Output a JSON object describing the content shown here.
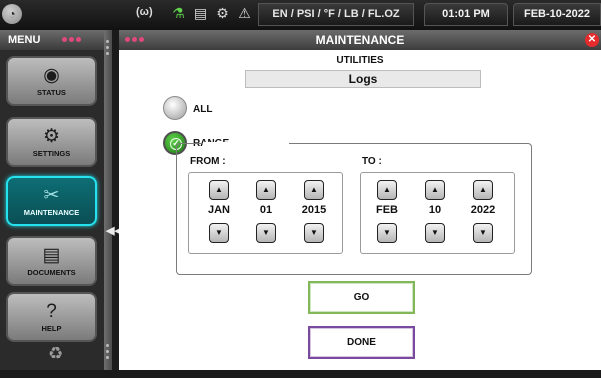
{
  "topbar": {
    "logo_icon": "gauge-logo-icon",
    "wifi_text": "(ω)",
    "icons": [
      "microscope-icon",
      "document-icon",
      "gear-green-icon",
      "warning-icon"
    ],
    "units_text": "EN / PSI / °F / LB / FL.OZ",
    "time_text": "01:01 PM",
    "date_text": "FEB-10-2022"
  },
  "sidebar": {
    "title": "MENU",
    "items": [
      {
        "label": "STATUS",
        "icon": "gauge-icon",
        "active": false
      },
      {
        "label": "SETTINGS",
        "icon": "gear-icon",
        "active": false
      },
      {
        "label": "MAINTENANCE",
        "icon": "tools-icon",
        "active": true
      },
      {
        "label": "DOCUMENTS",
        "icon": "document-icon",
        "active": false
      },
      {
        "label": "HELP",
        "icon": "help-icon",
        "active": false
      }
    ],
    "bottom_icon": "recycle-icon",
    "collapse_icon": "double-left-arrow-icon"
  },
  "main": {
    "title": "MAINTENANCE",
    "section": "UTILITIES",
    "logs_label": "Logs",
    "radio_all": "ALL",
    "radio_range": "RANGE",
    "selected_radio": "RANGE",
    "from_label": "FROM :",
    "to_label": "TO :",
    "from": {
      "month": "JAN",
      "day": "01",
      "year": "2015"
    },
    "to": {
      "month": "FEB",
      "day": "10",
      "year": "2022"
    },
    "go_label": "GO",
    "done_label": "DONE"
  },
  "colors": {
    "active_accent": "#25e2ee",
    "radio_selected": "#3fae2f",
    "go_border": "#83b85a",
    "done_border": "#7a4a9e",
    "close": "#e52b2b"
  }
}
